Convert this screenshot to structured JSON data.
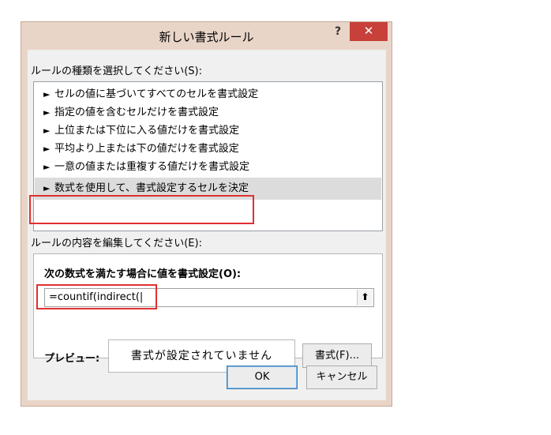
{
  "dialog": {
    "title": "新しい書式ルール",
    "help_label": "?",
    "close_label": "✕"
  },
  "rule_type": {
    "label": "ルールの種類を選択してください(S):",
    "items": [
      {
        "label": "セルの値に基づいてすべてのセルを書式設定"
      },
      {
        "label": "指定の値を含むセルだけを書式設定"
      },
      {
        "label": "上位または下位に入る値だけを書式設定"
      },
      {
        "label": "平均より上または下の値だけを書式設定"
      },
      {
        "label": "一意の値または重複する値だけを書式設定"
      },
      {
        "label": "数式を使用して、書式設定するセルを決定"
      }
    ],
    "arrow": "►"
  },
  "rule_edit": {
    "label": "ルールの内容を編集してください(E):",
    "formula_label": "次の数式を満たす場合に値を書式設定(O):",
    "formula_value": "=countif(indirect(|",
    "collapse_icon": "⬆"
  },
  "preview": {
    "label": "プレビュー:",
    "text": "書式が設定されていません",
    "format_button": "書式(F)..."
  },
  "buttons": {
    "ok": "OK",
    "cancel": "キャンセル"
  }
}
